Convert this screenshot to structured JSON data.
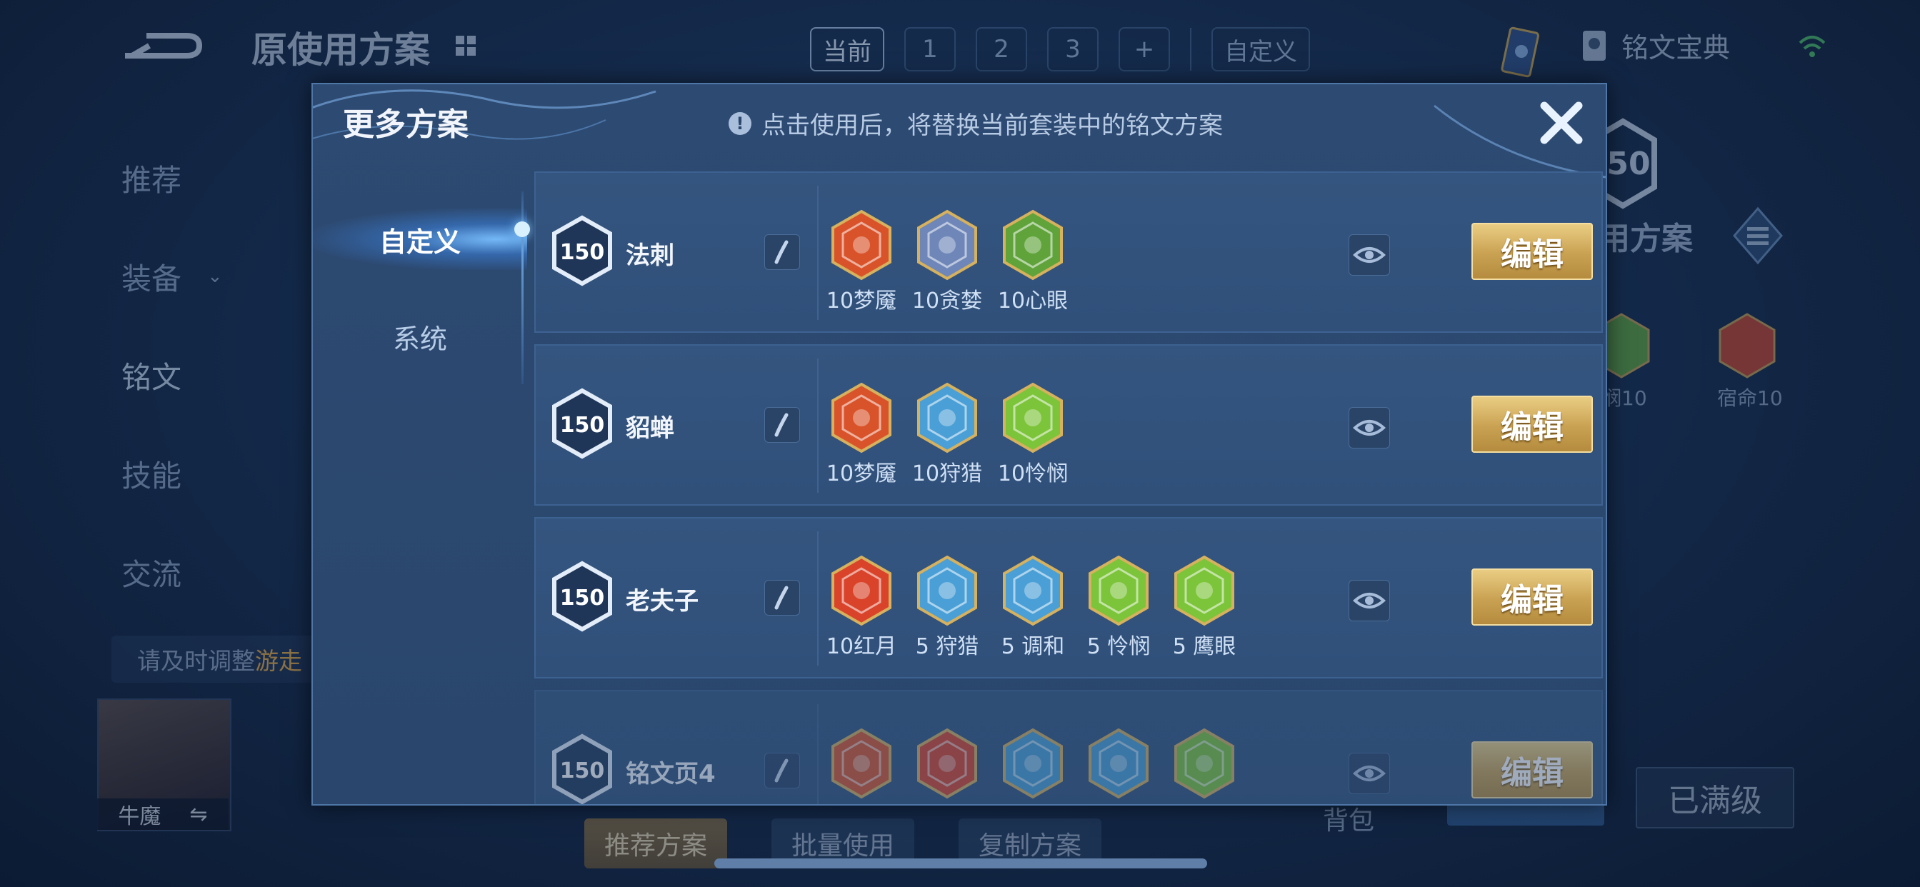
{
  "background": {
    "page_title": "原使用方案",
    "plan_tabs": [
      "当前",
      "1",
      "2",
      "3",
      "+"
    ],
    "custom_tab": "自定义",
    "codex_label": "铭文宝典",
    "side_nav": [
      "推荐",
      "装备",
      "铭文",
      "技能",
      "交流"
    ],
    "notice_prefix": "请及时调整",
    "notice_highlight": "游走",
    "hero_name": "牛魔",
    "hero_swap_icon": "⇋",
    "bottom_buttons": [
      "推荐方案",
      "批量使用",
      "复制方案"
    ],
    "bag_label": "背包",
    "maxed_label": "已满级",
    "right_title": "用方案",
    "right_level": "50",
    "right_runes": [
      "悯10",
      "宿命10"
    ]
  },
  "modal": {
    "title": "更多方案",
    "hint": "点击使用后，将替换当前套装中的铭文方案",
    "close_icon": "close-icon",
    "tabs": [
      "自定义",
      "系统"
    ],
    "edit_label": "编辑",
    "plans": [
      {
        "level": "150",
        "name": "法刺",
        "runes": [
          {
            "label": "10梦魇",
            "color": "#d9532a"
          },
          {
            "label": "10贪婪",
            "color": "#6e86b8"
          },
          {
            "label": "10心眼",
            "color": "#5fa33a"
          }
        ]
      },
      {
        "level": "150",
        "name": "貂蝉",
        "runes": [
          {
            "label": "10梦魇",
            "color": "#d9532a"
          },
          {
            "label": "10狩猎",
            "color": "#4a9fd6"
          },
          {
            "label": "10怜悯",
            "color": "#7cc43a"
          }
        ]
      },
      {
        "level": "150",
        "name": "老夫子",
        "runes": [
          {
            "label": "10红月",
            "color": "#d9432a"
          },
          {
            "label": "5 狩猎",
            "color": "#4a9fd6"
          },
          {
            "label": "5 调和",
            "color": "#4a9fd6"
          },
          {
            "label": "5 怜悯",
            "color": "#7cc43a"
          },
          {
            "label": "5 鹰眼",
            "color": "#7cc43a"
          }
        ]
      },
      {
        "level": "150",
        "name": "铭文页4",
        "runes": [
          {
            "label": "",
            "color": "#d9532a"
          },
          {
            "label": "",
            "color": "#d9432a"
          },
          {
            "label": "",
            "color": "#4a9fd6"
          },
          {
            "label": "",
            "color": "#4a9fd6"
          },
          {
            "label": "",
            "color": "#7cc43a"
          }
        ]
      }
    ]
  },
  "colors": {
    "accent_gold": "#c9a152",
    "panel": "#2d4a72",
    "row": "#34557f"
  }
}
